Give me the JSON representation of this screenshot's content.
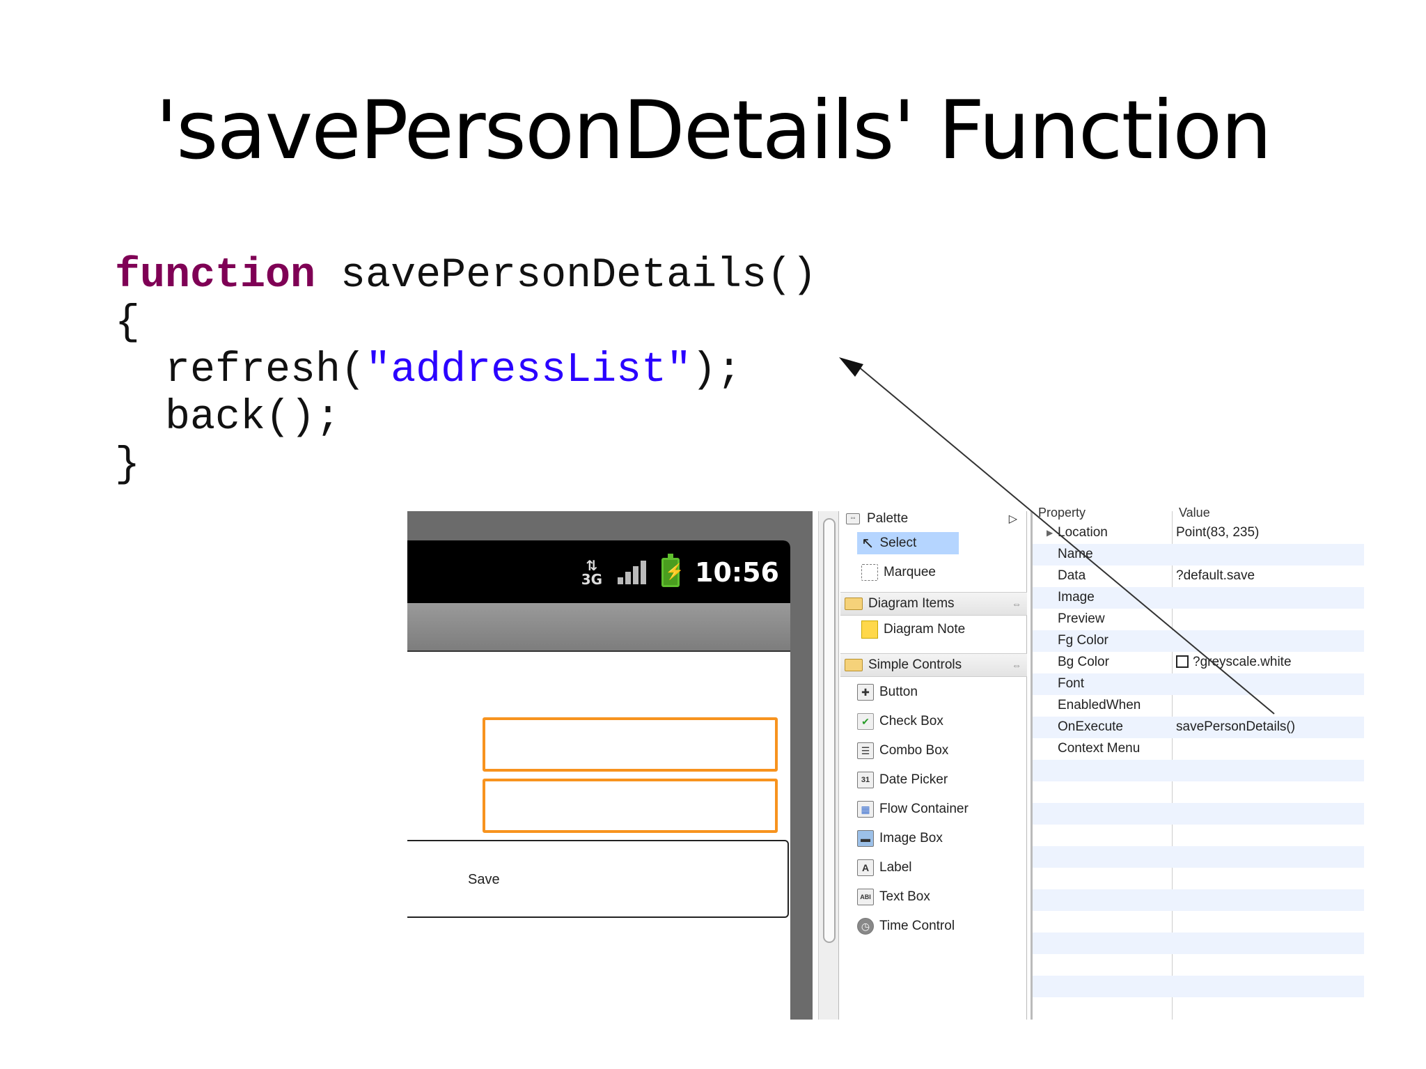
{
  "slide": {
    "title": "'savePersonDetails' Function"
  },
  "code": {
    "line1_kw": "function",
    "line1_rest": " savePersonDetails()",
    "line2": "{",
    "line3_pre": "  refresh(",
    "line3_str": "\"addressList\"",
    "line3_post": ");",
    "line4": "  back();",
    "line5": "}"
  },
  "phone": {
    "network_label": "3G",
    "clock": "10:56",
    "save_button_label": "Save",
    "colors": {
      "field_border": "#f7931e",
      "battery": "#4a9d1f"
    }
  },
  "palette": {
    "header": "Palette",
    "tools": [
      {
        "label": "Select",
        "icon": "cursor-icon"
      },
      {
        "label": "Marquee",
        "icon": "marquee-icon"
      }
    ],
    "groups": [
      {
        "label": "Diagram Items",
        "items": [
          {
            "label": "Diagram Note",
            "icon": "note-icon"
          }
        ]
      },
      {
        "label": "Simple Controls",
        "items": [
          {
            "label": "Button",
            "icon": "button-icon"
          },
          {
            "label": "Check Box",
            "icon": "checkbox-icon"
          },
          {
            "label": "Combo Box",
            "icon": "combobox-icon"
          },
          {
            "label": "Date Picker",
            "icon": "date-picker-icon"
          },
          {
            "label": "Flow Container",
            "icon": "flow-container-icon"
          },
          {
            "label": "Image Box",
            "icon": "image-box-icon"
          },
          {
            "label": "Label",
            "icon": "label-icon"
          },
          {
            "label": "Text Box",
            "icon": "text-box-icon"
          },
          {
            "label": "Time Control",
            "icon": "time-control-icon"
          }
        ]
      }
    ]
  },
  "properties": {
    "header_property": "Property",
    "header_value": "Value",
    "rows": [
      {
        "name": "Location",
        "value": "Point(83, 235)"
      },
      {
        "name": "Name",
        "value": ""
      },
      {
        "name": "Data",
        "value": "?default.save"
      },
      {
        "name": "Image",
        "value": ""
      },
      {
        "name": "Preview",
        "value": ""
      },
      {
        "name": "Fg Color",
        "value": ""
      },
      {
        "name": "Bg Color",
        "value": "?greyscale.white"
      },
      {
        "name": "Font",
        "value": ""
      },
      {
        "name": "EnabledWhen",
        "value": ""
      },
      {
        "name": "OnExecute",
        "value": "savePersonDetails()"
      },
      {
        "name": "Context Menu",
        "value": ""
      }
    ]
  }
}
